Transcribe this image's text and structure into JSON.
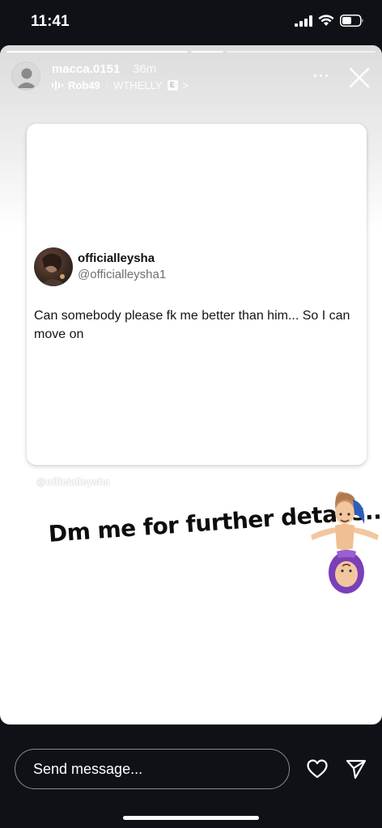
{
  "status_bar": {
    "time": "11:41"
  },
  "story": {
    "username": "macca.0151",
    "time_ago": "36m",
    "music": {
      "track": "Rob49",
      "separator": "·",
      "artist": "WTHELLY",
      "explicit": "E",
      "chevron": ">"
    },
    "more": "···",
    "progress": {
      "segments": 3,
      "current": 2
    }
  },
  "tweet": {
    "display_name": "officialleysha",
    "handle": "@officialleysha1",
    "text": "Can somebody please fk me better than him... So I can move on"
  },
  "watermark": "@officialleysha",
  "sticker_text": "Dm me for further details...",
  "bottom_bar": {
    "message_placeholder": "Send message..."
  },
  "icons": {
    "signal": "signal-bars-icon",
    "wifi": "wifi-icon",
    "battery": "battery-icon",
    "close": "close-icon",
    "heart": "heart-icon",
    "send": "send-icon",
    "music": "music-bars-icon"
  }
}
